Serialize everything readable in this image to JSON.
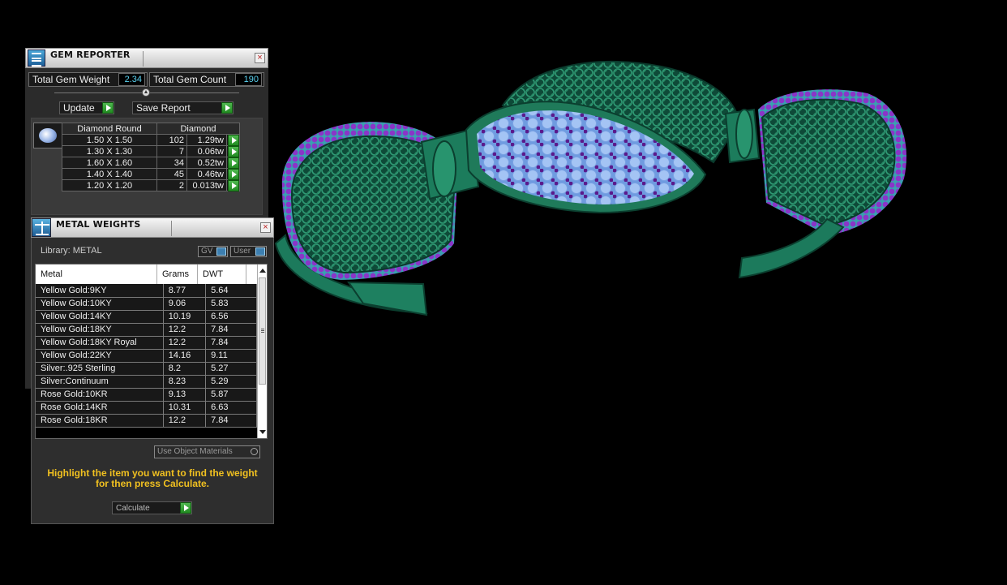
{
  "gem_reporter": {
    "title": "GEM REPORTER",
    "close_glyph": "×",
    "icon": "gem-reporter-icon",
    "total_weight_label": "Total Gem Weight",
    "total_weight_value": "2.34",
    "total_count_label": "Total Gem Count",
    "total_count_value": "190",
    "update_label": "Update",
    "save_report_label": "Save Report",
    "shape_header": "Diamond Round",
    "material_header": "Diamond",
    "rows": [
      {
        "size": "1.50 X 1.50",
        "count": "102",
        "weight": "1.29tw"
      },
      {
        "size": "1.30 X 1.30",
        "count": "7",
        "weight": "0.06tw"
      },
      {
        "size": "1.60 X 1.60",
        "count": "34",
        "weight": "0.52tw"
      },
      {
        "size": "1.40 X 1.40",
        "count": "45",
        "weight": "0.46tw"
      },
      {
        "size": "1.20 X 1.20",
        "count": "2",
        "weight": "0.013tw"
      }
    ]
  },
  "metal_weights": {
    "title": "METAL WEIGHTS",
    "close_glyph": "×",
    "icon": "scale-icon",
    "library_label": "Library: METAL",
    "gv_toggle": "GV",
    "user_toggle": "User",
    "columns": [
      "Metal",
      "Grams",
      "DWT"
    ],
    "rows": [
      {
        "metal": "Yellow Gold:9KY",
        "grams": "8.77",
        "dwt": "5.64"
      },
      {
        "metal": "Yellow Gold:10KY",
        "grams": "9.06",
        "dwt": "5.83"
      },
      {
        "metal": "Yellow Gold:14KY",
        "grams": "10.19",
        "dwt": "6.56"
      },
      {
        "metal": "Yellow Gold:18KY",
        "grams": "12.2",
        "dwt": "7.84"
      },
      {
        "metal": "Yellow Gold:18KY Royal",
        "grams": "12.2",
        "dwt": "7.84"
      },
      {
        "metal": "Yellow Gold:22KY",
        "grams": "14.16",
        "dwt": "9.11"
      },
      {
        "metal": "Silver:.925 Sterling",
        "grams": "8.2",
        "dwt": "5.27"
      },
      {
        "metal": "Silver:Continuum",
        "grams": "8.23",
        "dwt": "5.29"
      },
      {
        "metal": "Rose Gold:10KR",
        "grams": "9.13",
        "dwt": "5.87"
      },
      {
        "metal": "Rose Gold:14KR",
        "grams": "10.31",
        "dwt": "6.63"
      },
      {
        "metal": "Rose Gold:18KR",
        "grams": "12.2",
        "dwt": "7.84"
      }
    ],
    "use_object_materials_label": "Use Object Materials",
    "instruction": "Highlight the item you want to find the weight for then press Calculate.",
    "calculate_label": "Calculate"
  },
  "colors": {
    "metal_green": "#1f7a5a",
    "gem_blue": "#8cb4ee",
    "prong_purple": "#7a2ab8",
    "value_cyan": "#5ad2f0",
    "instruction_yellow": "#f0c020"
  }
}
